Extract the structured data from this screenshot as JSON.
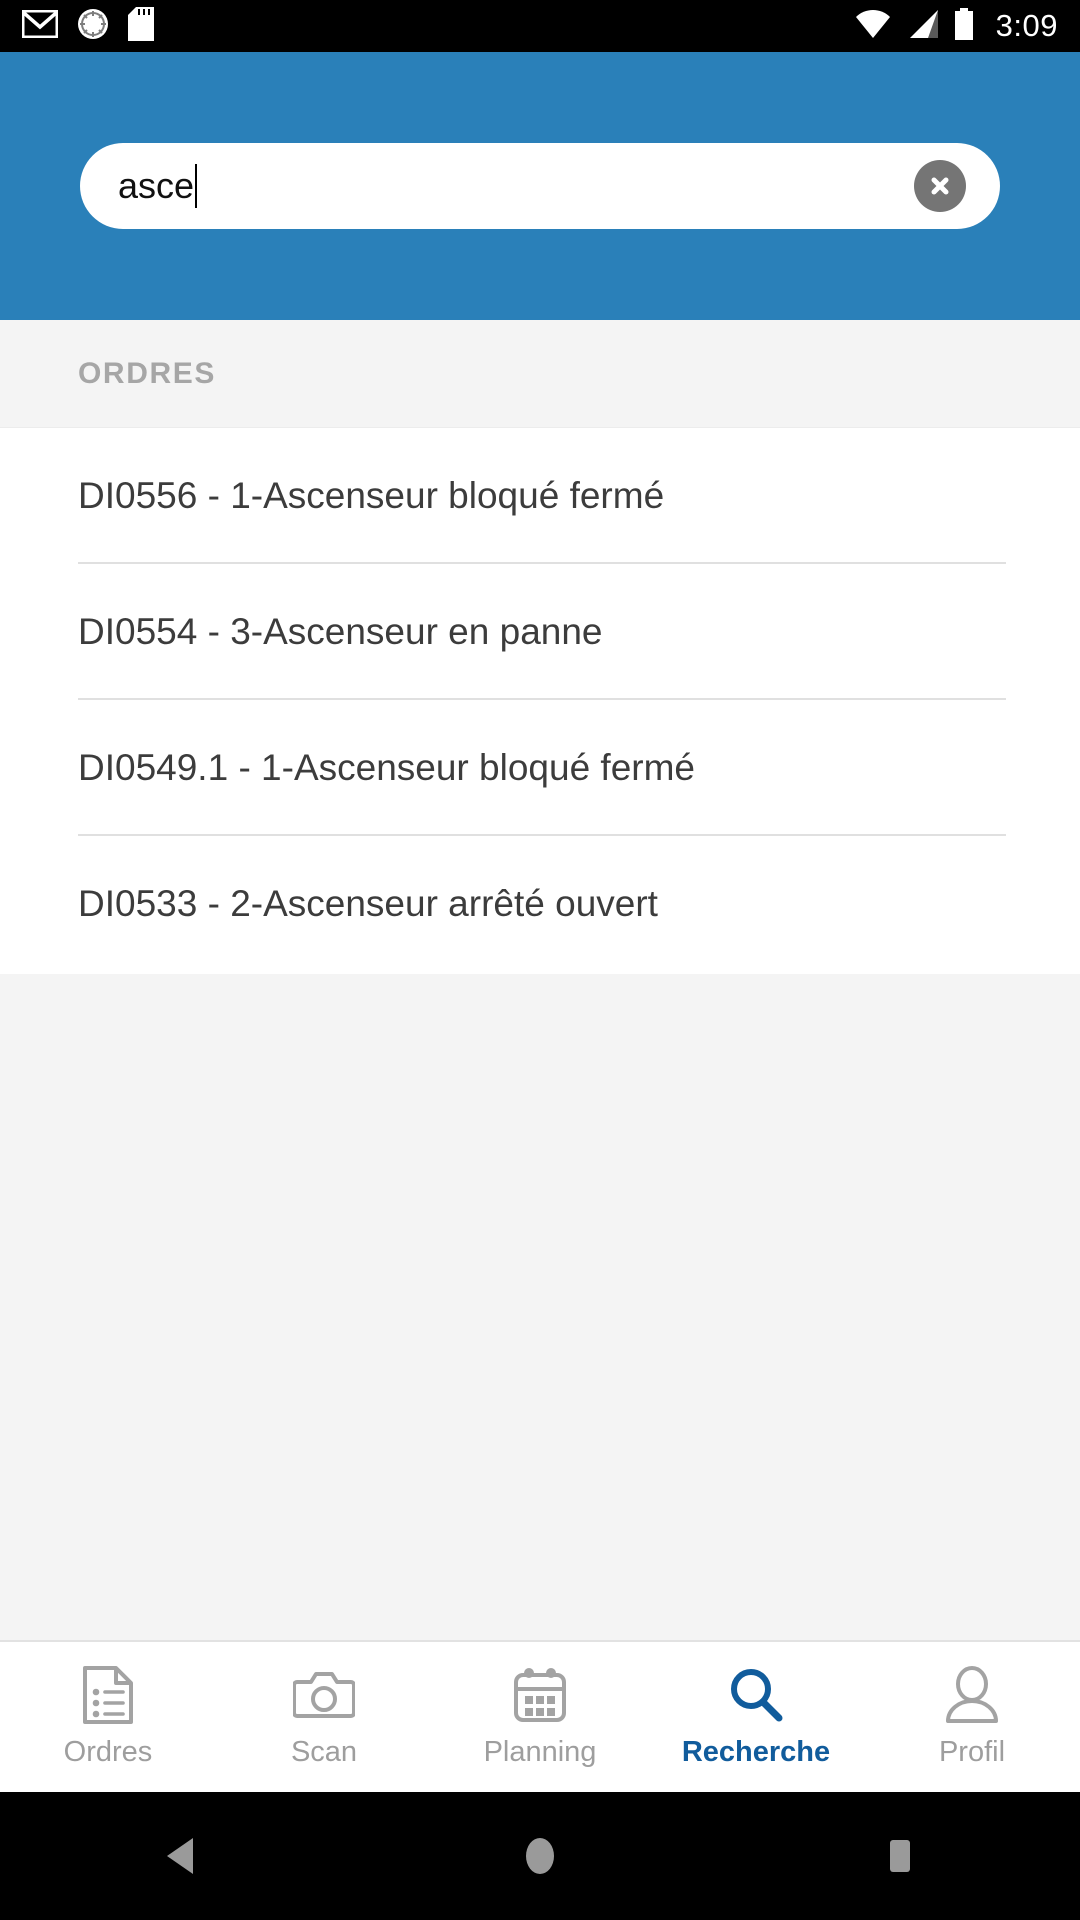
{
  "status_bar": {
    "time": "3:09",
    "left_icons": [
      "gmail-icon",
      "sync-icon",
      "sd-card-icon"
    ],
    "right_icons": [
      "wifi-icon",
      "cellular-signal-icon",
      "battery-icon"
    ]
  },
  "header": {
    "background_color": "#2a80b9",
    "search": {
      "value": "asce",
      "placeholder": "",
      "clear_icon": "clear-circle-icon"
    }
  },
  "section": {
    "title": "ORDRES"
  },
  "results": [
    {
      "label": "DI0556 - 1-Ascenseur bloqué fermé"
    },
    {
      "label": "DI0554 - 3-Ascenseur en panne"
    },
    {
      "label": "DI0549.1 - 1-Ascenseur bloqué fermé"
    },
    {
      "label": "DI0533 - 2-Ascenseur arrêté ouvert"
    }
  ],
  "tabs": [
    {
      "label": "Ordres",
      "icon": "document-list-icon",
      "active": false
    },
    {
      "label": "Scan",
      "icon": "camera-icon",
      "active": false
    },
    {
      "label": "Planning",
      "icon": "calendar-icon",
      "active": false
    },
    {
      "label": "Recherche",
      "icon": "search-icon",
      "active": true
    },
    {
      "label": "Profil",
      "icon": "person-icon",
      "active": false
    }
  ],
  "colors": {
    "accent": "#115c9c",
    "header": "#2a80b9",
    "inactive": "#9e9e9e",
    "divider": "#e0e0e0",
    "page_background": "#f4f4f4"
  },
  "system_nav": {
    "back": "back-triangle-icon",
    "home": "home-circle-icon",
    "recents": "recents-square-icon"
  }
}
